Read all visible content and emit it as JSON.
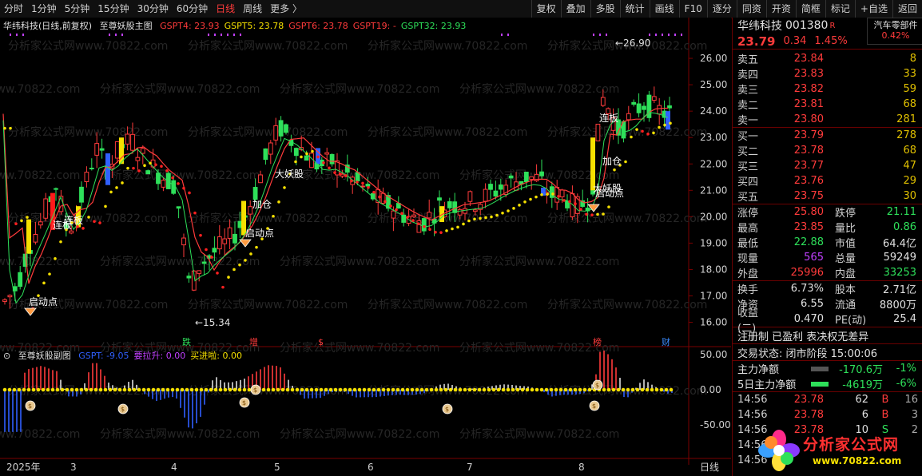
{
  "toolbar": {
    "periods": [
      "分时",
      "1分钟",
      "5分钟",
      "15分钟",
      "30分钟",
      "60分钟",
      "日线",
      "周线",
      "更多 〉"
    ],
    "active_period": "日线",
    "buttons": [
      "复权",
      "叠加",
      "多股",
      "统计",
      "画线",
      "F10",
      "逐分",
      "同资",
      "开资",
      "简框",
      "标记",
      "+自选",
      "返回"
    ]
  },
  "main_chart": {
    "header_name": "华纬科技(日线,前复权)",
    "indicator_name": "至尊妖股主图",
    "legend": [
      {
        "label": "GSPT4: 23.93",
        "color": "#ff3b3b"
      },
      {
        "label": "GSPT5: 23.78",
        "color": "#f5e000"
      },
      {
        "label": "GSPT6: 23.78",
        "color": "#ff3b3b"
      },
      {
        "label": "GSPT19: -",
        "color": "#ff3b3b"
      },
      {
        "label": "GSPT32: 23.93",
        "color": "#2ee05a"
      }
    ],
    "high_label": "26.90",
    "low_label": "15.34",
    "y_ticks": [
      "26.00",
      "25.00",
      "24.00",
      "23.00",
      "22.00",
      "21.00",
      "20.00",
      "19.00",
      "18.00",
      "17.00",
      "16.00"
    ],
    "annotations": [
      "启动点",
      "连板",
      "连板",
      "加仓",
      "启动点",
      "大妖股",
      "连板",
      "加仓",
      "启动点",
      "大妖股"
    ],
    "event_marks": [
      {
        "text": "跌",
        "color": "#2ee05a"
      },
      {
        "text": "增",
        "color": "#ff3b3b"
      },
      {
        "text": "$",
        "color": "#ff3b3b"
      },
      {
        "text": "榜",
        "color": "#ff3b3b"
      },
      {
        "text": "财",
        "color": "#3a8cff"
      }
    ]
  },
  "sub_chart": {
    "indicator_name": "至尊妖股副图",
    "legend": [
      {
        "label": "GSPT: -9.05",
        "color": "#3060ff"
      },
      {
        "label": "要拉升: 0.00",
        "color": "#c040ff"
      },
      {
        "label": "买进啦: 0.00",
        "color": "#f5e000"
      }
    ],
    "y_ticks": [
      "50.00",
      "0.00",
      "-50.00"
    ]
  },
  "x_axis": {
    "labels": [
      "2025年",
      "3",
      "4",
      "5",
      "6",
      "7",
      "8"
    ],
    "period_label": "日线"
  },
  "watermark": "分析家公式网www.70822.com",
  "side": {
    "stock_name": "华纬科技",
    "stock_code": "001380",
    "r_mark": "R",
    "sector": "汽车零部件",
    "sector_pct": "0.42%",
    "price": "23.79",
    "change": "0.34",
    "change_pct": "1.45%",
    "asks": [
      {
        "label": "卖五",
        "price": "23.84",
        "vol": "8"
      },
      {
        "label": "卖四",
        "price": "23.83",
        "vol": "33"
      },
      {
        "label": "卖三",
        "price": "23.82",
        "vol": "59"
      },
      {
        "label": "卖二",
        "price": "23.81",
        "vol": "68"
      },
      {
        "label": "卖一",
        "price": "23.80",
        "vol": "281"
      }
    ],
    "bids": [
      {
        "label": "买一",
        "price": "23.79",
        "vol": "278"
      },
      {
        "label": "买二",
        "price": "23.78",
        "vol": "68"
      },
      {
        "label": "买三",
        "price": "23.77",
        "vol": "47"
      },
      {
        "label": "买四",
        "price": "23.76",
        "vol": "29"
      },
      {
        "label": "买五",
        "price": "23.75",
        "vol": "30"
      }
    ],
    "quote": [
      {
        "k1": "涨停",
        "v1": "25.80",
        "c1": "red",
        "k2": "跌停",
        "v2": "21.11",
        "c2": "green"
      },
      {
        "k1": "最高",
        "v1": "23.85",
        "c1": "red",
        "k2": "量比",
        "v2": "0.86",
        "c2": "green"
      },
      {
        "k1": "最低",
        "v1": "22.88",
        "c1": "green",
        "k2": "市值",
        "v2": "64.4亿",
        "c2": "white"
      },
      {
        "k1": "现量",
        "v1": "565",
        "c1": "purple",
        "k2": "总量",
        "v2": "59249",
        "c2": "white"
      },
      {
        "k1": "外盘",
        "v1": "25996",
        "c1": "red",
        "k2": "内盘",
        "v2": "33253",
        "c2": "green"
      }
    ],
    "finance": [
      {
        "k1": "换手",
        "v1": "6.73%",
        "k2": "股本",
        "v2": "2.71亿"
      },
      {
        "k1": "净资",
        "v1": "6.55",
        "k2": "流通",
        "v2": "8800万"
      },
      {
        "k1": "收益(二)",
        "v1": "0.470",
        "k2": "PE(动)",
        "v2": "25.4"
      }
    ],
    "tags": "注册制 已盈利 表决权无差异",
    "trade_status": "交易状态: 闭市阶段 15:00:06",
    "flows": [
      {
        "k": "主力净额",
        "v": "-170.6万",
        "p": "-1%"
      },
      {
        "k": "5日主力净额",
        "v": "-4619万",
        "p": "-6%"
      }
    ],
    "ticks": [
      {
        "t": "14:56",
        "p": "23.78",
        "n": "62",
        "bs": "B",
        "c": "16"
      },
      {
        "t": "14:56",
        "p": "23.78",
        "n": "6",
        "bs": "B",
        "c": "3"
      },
      {
        "t": "14:56",
        "p": "23.78",
        "n": "10",
        "bs": "S",
        "c": "2"
      },
      {
        "t": "14:56",
        "p": "",
        "n": "",
        "bs": "",
        "c": ""
      },
      {
        "t": "14:56",
        "p": "",
        "n": "",
        "bs": "",
        "c": ""
      }
    ],
    "logo_cn": "分析家公式网",
    "logo_url": "www.70822.com"
  }
}
